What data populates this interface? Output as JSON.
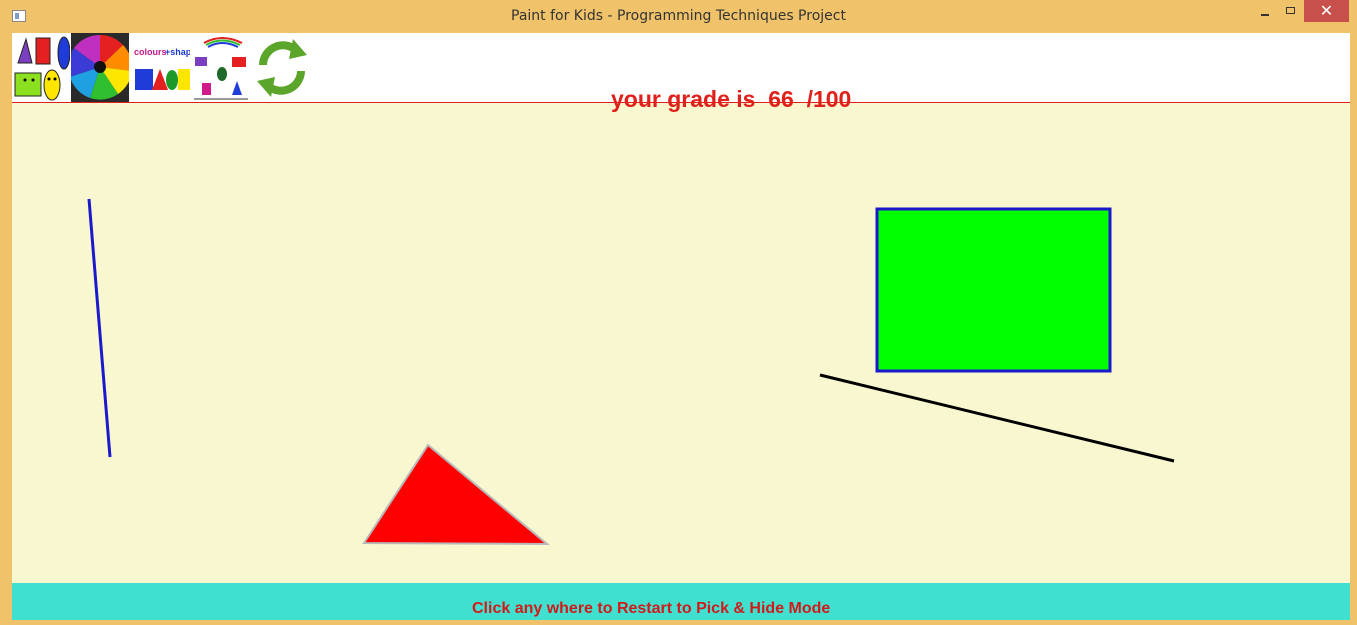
{
  "window": {
    "title": "Paint for Kids - Programming Techniques Project",
    "minimize_label": "",
    "maximize_label": "",
    "close_label": "✕"
  },
  "toolbar": {
    "items": [
      {
        "name": "shapes-tool",
        "icon": "shapes-icon"
      },
      {
        "name": "colors-tool",
        "icon": "color-wheel-icon"
      },
      {
        "name": "colours-and-shapes-tool",
        "icon": "colours-shapes-icon",
        "caption": "colours + shapes"
      },
      {
        "name": "pick-shapes-tool",
        "icon": "shape-set-icon"
      },
      {
        "name": "restart-tool",
        "icon": "refresh-icon"
      }
    ]
  },
  "grade": {
    "text": "your grade is  66  /100"
  },
  "canvas": {
    "background": "#f8f7d0",
    "shapes": [
      {
        "type": "line",
        "color": "#1a1acc"
      },
      {
        "type": "triangle",
        "fill": "#ff0000",
        "stroke": "#b8b8b8"
      },
      {
        "type": "rectangle",
        "fill": "#00ff00",
        "stroke": "#1a1acc"
      },
      {
        "type": "line",
        "color": "#000000"
      }
    ]
  },
  "status": {
    "text": "Click any where to Restart to Pick & Hide Mode",
    "background": "#40e0d0",
    "color": "#d11a1a"
  },
  "colors": {
    "accent": "#e0201a",
    "frame": "#f0c36a"
  }
}
